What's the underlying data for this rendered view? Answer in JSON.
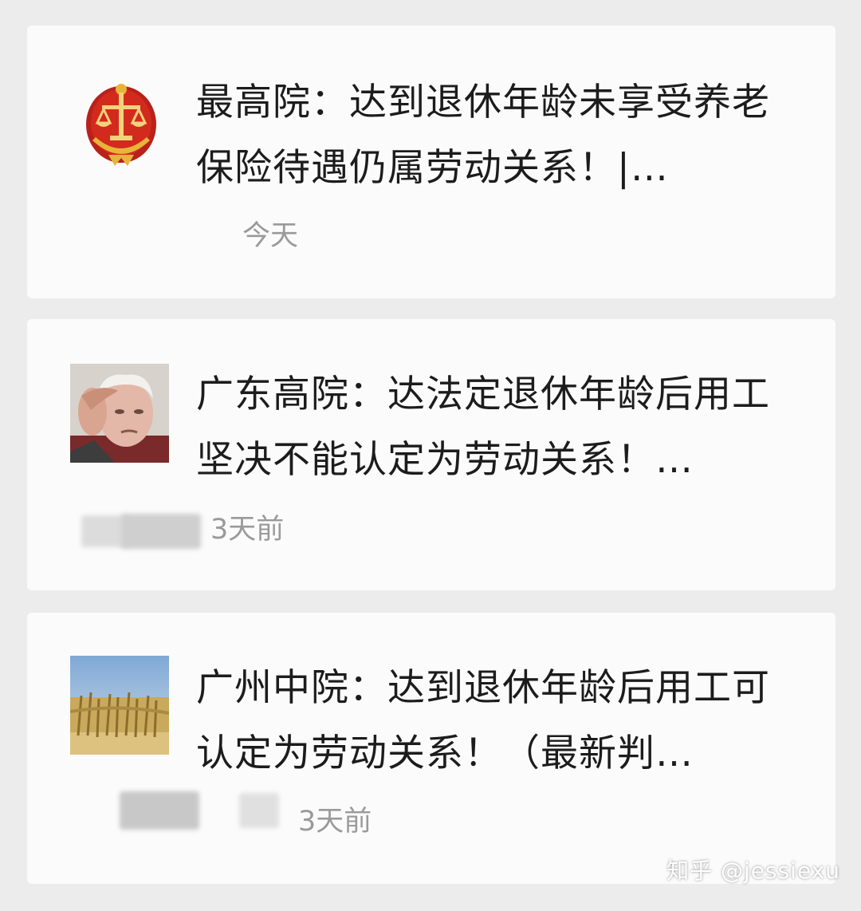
{
  "articles": [
    {
      "title": "最高院：达到退休年龄未享受养老保险待遇仍属劳动关系！|…",
      "time": "今天",
      "thumbnail": "court-emblem"
    },
    {
      "title": "广东高院：达法定退休年龄后用工坚决不能认定为劳动关系！…",
      "time": "3天前",
      "thumbnail": "elderly-man-photo"
    },
    {
      "title": "广州中院：达到退休年龄后用工可认定为劳动关系！（最新判…",
      "time": "3天前",
      "thumbnail": "wheat-field-photo"
    }
  ],
  "watermark": "知乎 @jessiexu",
  "colors": {
    "background": "#ececec",
    "card": "#fbfbfb",
    "title_text": "#1c1c1c",
    "meta_text": "#9a9a9a",
    "emblem_red": "#c8271c",
    "emblem_gold": "#e7b53a"
  }
}
